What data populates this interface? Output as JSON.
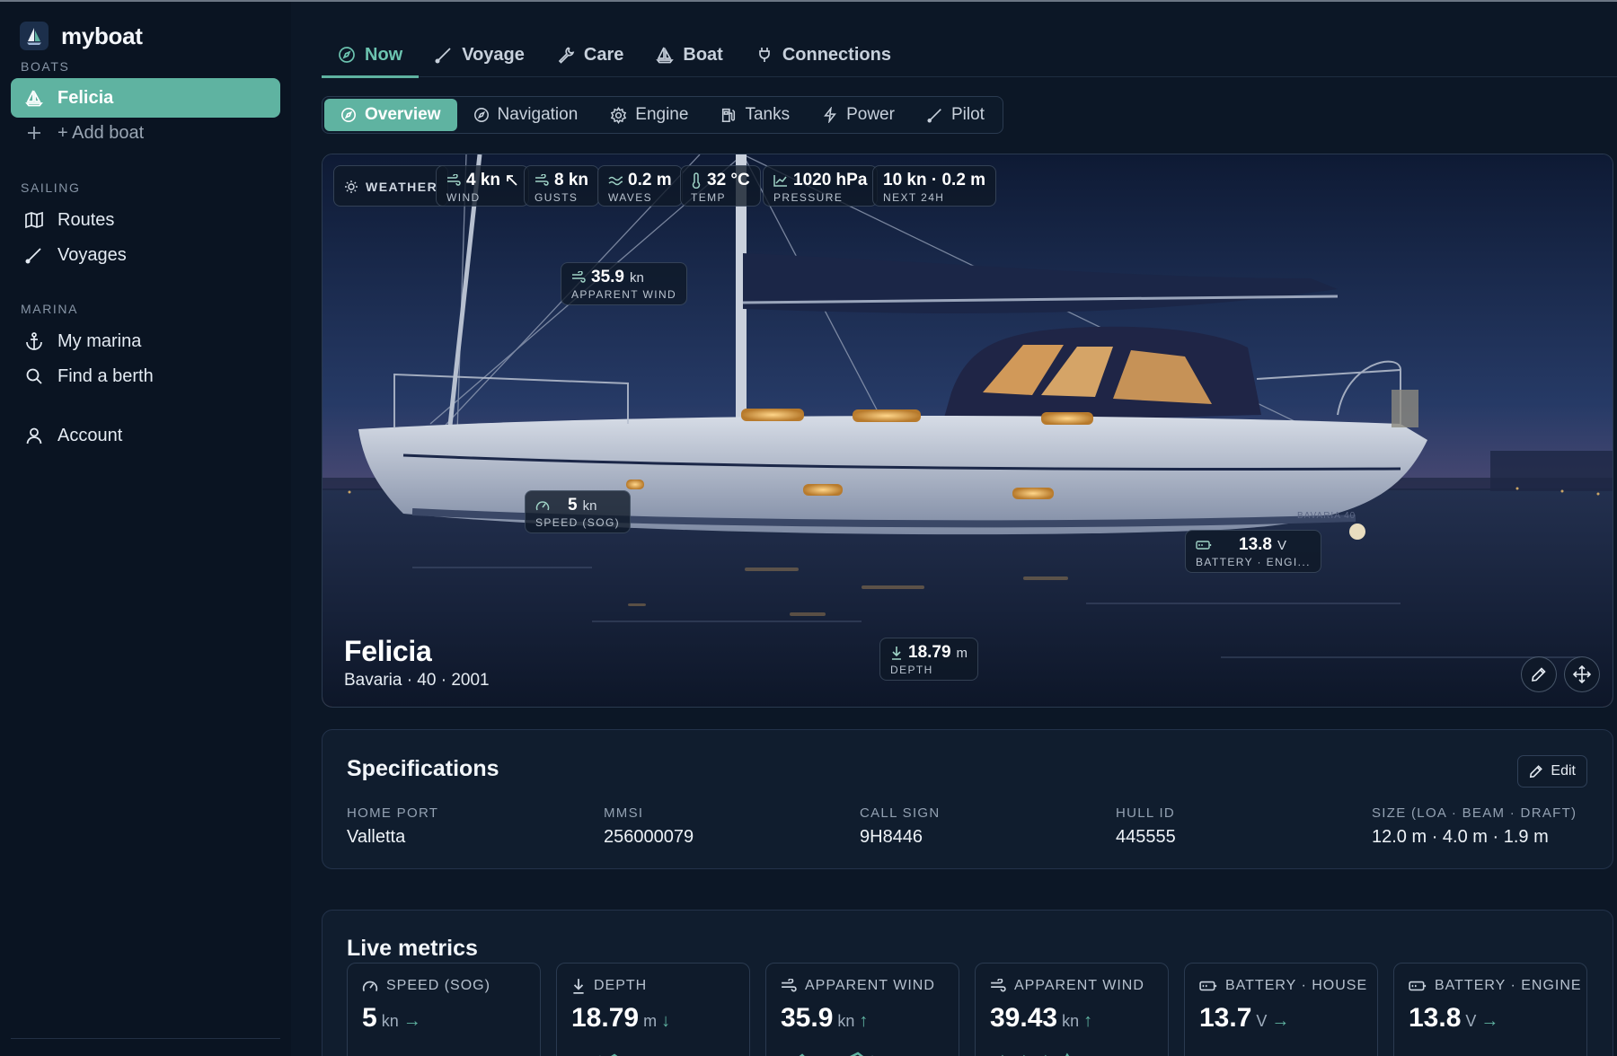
{
  "app": {
    "name": "myboat"
  },
  "sidebar": {
    "sections": {
      "boats": "BOATS",
      "sailing": "SAILING",
      "marina": "MARINA"
    },
    "boat": "Felicia",
    "add_boat": "+ Add boat",
    "sailing_items": [
      "Routes",
      "Voyages"
    ],
    "marina_items": [
      "My marina",
      "Find a berth"
    ],
    "account": "Account"
  },
  "tabs": [
    "Now",
    "Voyage",
    "Care",
    "Boat",
    "Connections"
  ],
  "subtabs": [
    "Overview",
    "Navigation",
    "Engine",
    "Tanks",
    "Power",
    "Pilot"
  ],
  "weather": {
    "label": "WEATHER",
    "wind": {
      "value": "4 kn",
      "label": "WIND"
    },
    "gusts": {
      "value": "8 kn",
      "label": "GUSTS"
    },
    "waves": {
      "value": "0.2 m",
      "label": "WAVES"
    },
    "temp": {
      "value": "32 °C",
      "label": "TEMP"
    },
    "pressure": {
      "value": "1020 hPa",
      "label": "PRESSURE"
    },
    "next": {
      "value": "10 kn · 0.2 m",
      "label": "NEXT 24H"
    }
  },
  "overlays": {
    "apparent_wind": {
      "value": "35.9",
      "unit": "kn",
      "label": "APPARENT WIND"
    },
    "speed": {
      "value": "5",
      "unit": "kn",
      "label": "SPEED (SOG)"
    },
    "battery": {
      "value": "13.8",
      "unit": "V",
      "label": "BATTERY · ENGI..."
    },
    "depth": {
      "value": "18.79",
      "unit": "m",
      "label": "DEPTH"
    }
  },
  "hero": {
    "name": "Felicia",
    "subtitle": "Bavaria · 40 · 2001",
    "hull_text": "BAVARIA 40"
  },
  "specs": {
    "title": "Specifications",
    "edit": "Edit",
    "items": [
      {
        "label": "HOME PORT",
        "value": "Valletta"
      },
      {
        "label": "MMSI",
        "value": "256000079"
      },
      {
        "label": "CALL SIGN",
        "value": "9H8446"
      },
      {
        "label": "HULL ID",
        "value": "445555"
      },
      {
        "label": "SIZE (LOA · BEAM · DRAFT)",
        "value": "12.0 m · 4.0 m · 1.9 m"
      }
    ]
  },
  "metrics": {
    "title": "Live metrics",
    "items": [
      {
        "label": "SPEED (SOG)",
        "value": "5",
        "unit": "kn",
        "trend": "→"
      },
      {
        "label": "DEPTH",
        "value": "18.79",
        "unit": "m",
        "trend": "↓"
      },
      {
        "label": "APPARENT WIND",
        "value": "35.9",
        "unit": "kn",
        "trend": "↑"
      },
      {
        "label": "APPARENT WIND",
        "value": "39.43",
        "unit": "kn",
        "trend": "↑"
      },
      {
        "label": "BATTERY · HOUSE",
        "value": "13.7",
        "unit": "V",
        "trend": "→"
      },
      {
        "label": "BATTERY · ENGINE",
        "value": "13.8",
        "unit": "V",
        "trend": "→"
      }
    ]
  },
  "colors": {
    "accent": "#5fb3a1",
    "background": "#0c1726",
    "card": "#101d2e"
  }
}
